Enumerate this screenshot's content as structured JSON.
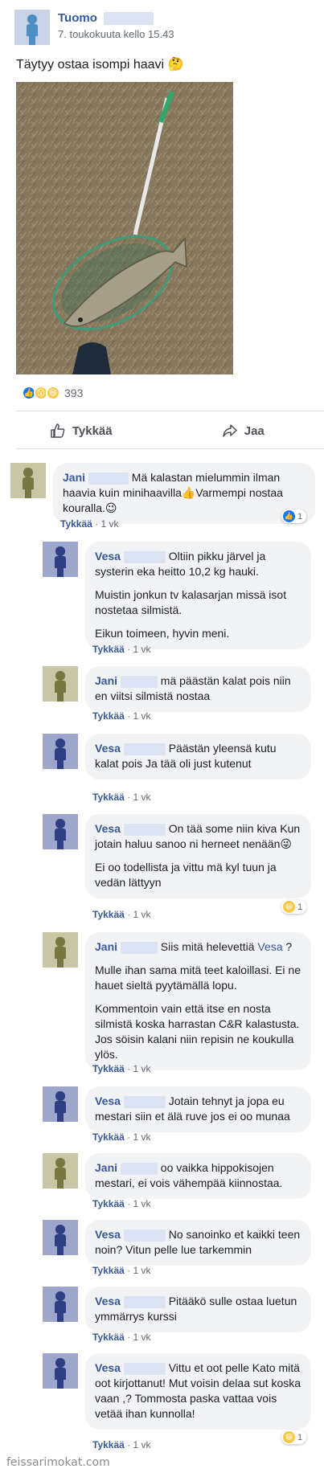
{
  "post": {
    "author": "Tuomo",
    "timestamp": "7. toukokuuta kello 15.43",
    "text": "Täytyy ostaa isompi haavi 🤔",
    "reaction_count": "393",
    "like_label": "Tykkää",
    "share_label": "Jaa"
  },
  "comments": [
    {
      "name": "Jani",
      "lines": [
        "Mä kalastan mielummin ilman haavia kuin minihaavilla👍Varmempi nostaa kouralla.😉"
      ],
      "like": "Tykkää",
      "time": "1 vk",
      "reaction": "1"
    },
    {
      "name": "Vesa",
      "lines": [
        "Oltiin pikku järvel ja systerin eka heitto 10,2 kg hauki.",
        "Muistin jonkun tv kalasarjan missä isot nostetaa silmistä.",
        "Eikun toimeen, hyvin meni."
      ],
      "like": "Tykkää",
      "time": "1 vk"
    },
    {
      "name": "Jani",
      "lines": [
        "mä päästän kalat pois niin en viitsi silmistä nostaa"
      ],
      "like": "Tykkää",
      "time": "1 vk"
    },
    {
      "name": "Vesa",
      "lines": [
        "Päästän yleensä kutu kalat pois Ja tää oli just kutenut"
      ],
      "like": "Tykkää",
      "time": "1 vk"
    },
    {
      "name": "Vesa",
      "lines": [
        "On tää some niin kiva Kun jotain haluu sanoo ni herneet nenään😜",
        "Ei oo todellista ja vittu mä kyl tuun ja vedän lättyyn"
      ],
      "like": "Tykkää",
      "time": "1 vk",
      "reaction": "1"
    },
    {
      "name": "Jani",
      "mention": "Vesa",
      "lines": [
        "Siis mitä helevettiä",
        "Mulle ihan sama mitä teet kaloillasi. Ei ne hauet sieltä pyytämällä lopu.",
        "Kommentoin vain että itse en nosta silmistä koska harrastan C&R kalastusta. Jos söisin kalani niin repisin ne koukulla ylös."
      ],
      "like": "Tykkää",
      "time": "1 vk"
    },
    {
      "name": "Vesa",
      "lines": [
        "Jotain tehnyt ja jopa eu mestari siin et älä ruve jos ei oo munaa"
      ],
      "like": "Tykkää",
      "time": "1 vk"
    },
    {
      "name": "Jani",
      "lines": [
        "oo vaikka hippokisojen mestari, ei vois vähempää kiinnostaa."
      ],
      "like": "Tykkää",
      "time": "1 vk"
    },
    {
      "name": "Vesa",
      "lines": [
        "No sanoinko et kaikki teen noin? Vitun pelle lue tarkemmin"
      ],
      "like": "Tykkää",
      "time": "1 vk"
    },
    {
      "name": "Vesa",
      "lines": [
        "Pitääkö sulle ostaa luetun ymmärrys kurssi"
      ],
      "like": "Tykkää",
      "time": "1 vk"
    },
    {
      "name": "Vesa",
      "lines": [
        "Vittu et oot pelle Kato mitä oot kirjottanut! Mut voisin delaa sut koska vaan ,? Tommosta paska vattaa vois vetää ihan kunnolla!"
      ],
      "like": "Tykkää",
      "time": "1 vk",
      "reaction": "1"
    }
  ],
  "watermark": "feissarimokat.com"
}
